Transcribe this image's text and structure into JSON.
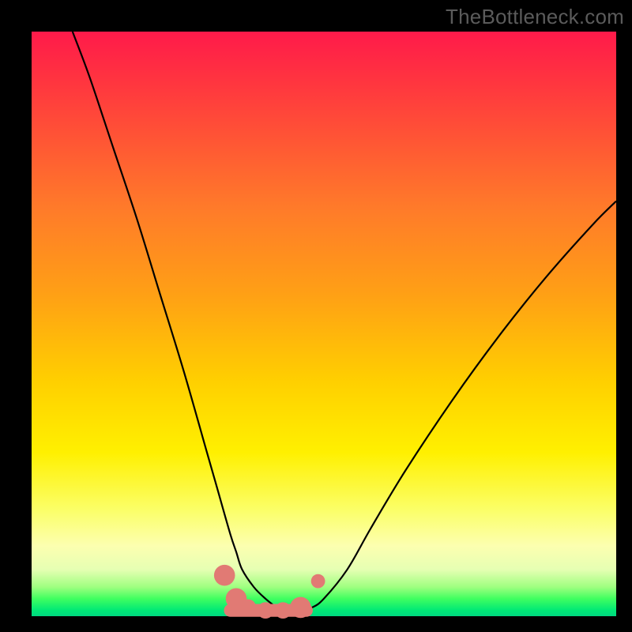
{
  "watermark": "TheBottleneck.com",
  "colors": {
    "background": "#000000",
    "gradient_top": "#ff1a4a",
    "gradient_mid": "#ffd000",
    "gradient_bottom": "#00d880",
    "curve_stroke": "#000000",
    "marker_fill": "#e17a74",
    "marker_stroke": "#e17a74"
  },
  "chart_data": {
    "type": "line",
    "title": "",
    "xlabel": "",
    "ylabel": "",
    "xlim": [
      0,
      100
    ],
    "ylim": [
      0,
      100
    ],
    "grid": false,
    "series": [
      {
        "name": "left-curve",
        "x": [
          7,
          10,
          14,
          18,
          22,
          26,
          30,
          32,
          34,
          35,
          36,
          38,
          40,
          42,
          44
        ],
        "y": [
          100,
          92,
          80,
          68,
          55,
          42,
          28,
          21,
          14,
          11,
          8,
          5,
          3,
          1.5,
          1
        ]
      },
      {
        "name": "right-curve",
        "x": [
          44,
          46,
          48,
          50,
          54,
          58,
          64,
          72,
          80,
          88,
          96,
          100
        ],
        "y": [
          1,
          1,
          1.5,
          3,
          8,
          15,
          25,
          37,
          48,
          58,
          67,
          71
        ]
      }
    ],
    "markers": [
      {
        "name": "trough-left-end",
        "x": 33,
        "y": 7,
        "r": 1.8
      },
      {
        "name": "trough-start",
        "x": 35,
        "y": 3,
        "r": 1.8
      },
      {
        "name": "trough-mid-1",
        "x": 37,
        "y": 1.5,
        "r": 1.4
      },
      {
        "name": "trough-mid-2",
        "x": 40,
        "y": 1,
        "r": 1.4
      },
      {
        "name": "trough-mid-3",
        "x": 43,
        "y": 1,
        "r": 1.4
      },
      {
        "name": "trough-end",
        "x": 46,
        "y": 1.5,
        "r": 1.8
      },
      {
        "name": "right-point",
        "x": 49,
        "y": 6,
        "r": 1.2
      }
    ],
    "trough_band": {
      "x0": 34,
      "x1": 47,
      "y": 1,
      "thickness": 2.2
    }
  }
}
